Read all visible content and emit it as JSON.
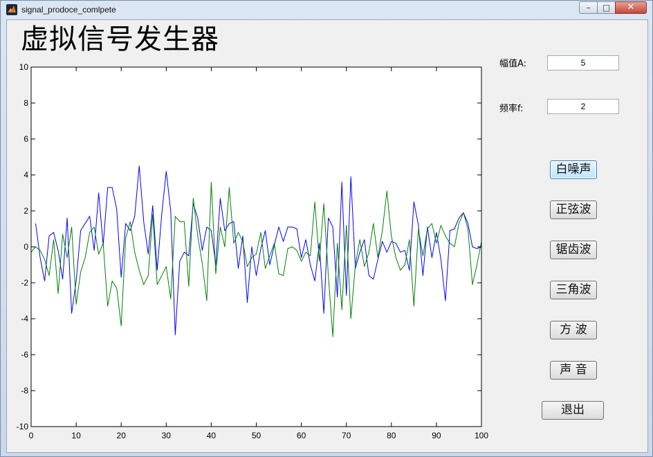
{
  "window": {
    "title": "signal_prodoce_comlpete",
    "controls": {
      "minimize": "–",
      "maximize": "□",
      "close": "✕"
    }
  },
  "header": {
    "title": "虚拟信号发生器"
  },
  "controls": {
    "amplitude_label": "幅值A:",
    "amplitude_value": "5",
    "frequency_label": "频率f:",
    "frequency_value": "2"
  },
  "buttons": {
    "white_noise": "白噪声",
    "sine": "正弦波",
    "sawtooth": "锯齿波",
    "triangle": "三角波",
    "square": "方  波",
    "sound": "声  音",
    "exit": "退出"
  },
  "colors": {
    "series_blue": "#0000ff",
    "series_green": "#008000",
    "axes": "#000000",
    "plot_bg": "#ffffff"
  },
  "chart_data": {
    "type": "line",
    "xlim": [
      0,
      100
    ],
    "ylim": [
      -10,
      10
    ],
    "x_ticks": [
      0,
      10,
      20,
      30,
      40,
      50,
      60,
      70,
      80,
      90,
      100
    ],
    "y_ticks": [
      -10,
      -8,
      -6,
      -4,
      -2,
      0,
      2,
      4,
      6,
      8,
      10
    ],
    "grid": false,
    "series": [
      {
        "color": "#0000ff",
        "x": [
          1,
          2,
          3,
          4,
          5,
          6,
          7,
          8,
          9,
          10,
          11,
          12,
          13,
          14,
          15,
          16,
          17,
          18,
          19,
          20,
          21,
          22,
          23,
          24,
          25,
          26,
          27,
          28,
          29,
          30,
          31,
          32,
          33,
          34,
          35,
          36,
          37,
          38,
          39,
          40,
          41,
          42,
          43,
          44,
          45,
          46,
          47,
          48,
          49,
          50,
          51,
          52,
          53,
          54,
          55,
          56,
          57,
          58,
          59,
          60,
          61,
          62,
          63,
          64,
          65,
          66,
          67,
          68,
          69,
          70,
          71,
          72,
          73,
          74,
          75,
          76,
          77,
          78,
          79,
          80,
          81,
          82,
          83,
          84,
          85,
          86,
          87,
          88,
          89,
          90,
          91,
          92,
          93,
          94,
          95,
          96,
          97,
          98,
          99,
          100
        ],
        "y": [
          1.3,
          -0.6,
          -1.9,
          0.6,
          0.8,
          -0.2,
          -1.8,
          1.6,
          -3.7,
          -1.9,
          0.9,
          1.3,
          1.7,
          -0.2,
          3.0,
          0.1,
          3.3,
          3.3,
          2.1,
          -1.7,
          1.3,
          0.9,
          1.7,
          4.5,
          1.4,
          -0.4,
          2.3,
          -1.3,
          1.8,
          4.2,
          2.0,
          -4.9,
          -0.8,
          -0.3,
          -0.5,
          2.4,
          1.6,
          -0.2,
          1.1,
          0.9,
          -1.0,
          2.7,
          0.9,
          1.3,
          1.4,
          -1.2,
          0.6,
          -3.1,
          0.0,
          -1.6,
          -0.1,
          0.9,
          -1.0,
          0.1,
          1.1,
          0.3,
          1.1,
          1.1,
          1.0,
          -0.6,
          0.4,
          -1.0,
          -1.9,
          0.2,
          -3.7,
          1.6,
          1.1,
          -2.8,
          3.6,
          -2.7,
          3.9,
          -1.2,
          -0.3,
          0.4,
          -1.6,
          -1.8,
          -0.7,
          0.3,
          -0.3,
          0.3,
          0.2,
          -0.3,
          -0.2,
          -1.3,
          2.5,
          1.2,
          -1.6,
          1.1,
          -0.6,
          0.8,
          -0.7,
          -3.0,
          0.9,
          1.0,
          1.6,
          1.9,
          1.3,
          0.0,
          -0.1,
          0.0
        ]
      },
      {
        "color": "#008000",
        "x": [
          0,
          1,
          2,
          3,
          4,
          5,
          6,
          7,
          8,
          9,
          10,
          11,
          12,
          13,
          14,
          15,
          16,
          17,
          18,
          19,
          20,
          21,
          22,
          23,
          24,
          25,
          26,
          27,
          28,
          29,
          30,
          31,
          32,
          33,
          34,
          35,
          36,
          37,
          38,
          39,
          40,
          41,
          42,
          43,
          44,
          45,
          46,
          47,
          48,
          49,
          50,
          51,
          52,
          53,
          54,
          55,
          56,
          57,
          58,
          59,
          60,
          61,
          62,
          63,
          64,
          65,
          66,
          67,
          68,
          69,
          70,
          71,
          72,
          73,
          74,
          75,
          76,
          77,
          78,
          79,
          80,
          81,
          82,
          83,
          84,
          85,
          86,
          87,
          88,
          89,
          90,
          91,
          92,
          93,
          94,
          95,
          96,
          97,
          98,
          99,
          100
        ],
        "y": [
          -0.3,
          0.0,
          -0.2,
          -0.7,
          -1.6,
          0.4,
          -2.6,
          0.7,
          -0.6,
          1.1,
          -3.2,
          -1.4,
          -0.6,
          0.8,
          1.1,
          -0.4,
          0.2,
          -3.3,
          -1.9,
          -2.3,
          -4.4,
          0.5,
          1.4,
          -0.3,
          -1.3,
          -2.1,
          -1.6,
          1.8,
          -2.1,
          -1.6,
          -1.1,
          -2.9,
          1.7,
          1.4,
          1.4,
          -2.2,
          2.7,
          0.6,
          -0.9,
          -3.0,
          3.6,
          -1.5,
          1.1,
          0.0,
          3.3,
          0.2,
          0.8,
          0.3,
          -1.1,
          -0.6,
          -0.4,
          0.8,
          -1.2,
          -0.5,
          0.2,
          -1.5,
          -1.6,
          -0.1,
          0.0,
          -0.2,
          -0.8,
          -0.3,
          -0.5,
          2.5,
          -0.8,
          2.4,
          -1.6,
          -5.0,
          0.2,
          -3.5,
          1.2,
          -4.0,
          -1.0,
          0.4,
          -1.1,
          -0.3,
          1.3,
          -0.6,
          0.9,
          3.1,
          0.6,
          -0.6,
          -1.3,
          -1.0,
          0.4,
          -3.3,
          1.0,
          -0.5,
          1.0,
          1.3,
          0.2,
          1.2,
          0.6,
          0.2,
          0.0,
          1.3,
          1.9,
          1.0,
          -2.1,
          -1.0,
          0.3
        ]
      }
    ]
  }
}
